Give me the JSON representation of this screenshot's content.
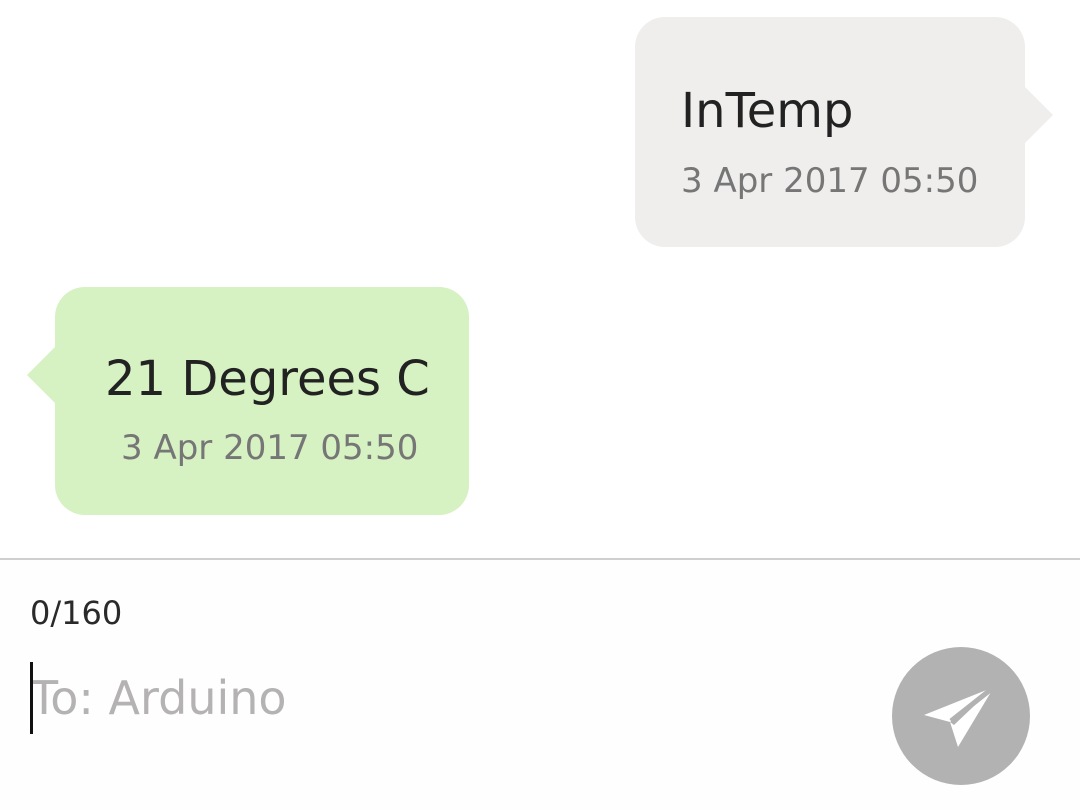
{
  "conversation": {
    "messages": [
      {
        "direction": "outgoing",
        "text": "InTemp",
        "timestamp": "3 Apr 2017 05:50"
      },
      {
        "direction": "incoming",
        "text": "21 Degrees C",
        "timestamp": "3 Apr 2017 05:50"
      }
    ]
  },
  "composer": {
    "char_counter": "0/160",
    "placeholder": "To: Arduino",
    "value": "",
    "send_icon": "send-icon"
  },
  "colors": {
    "outgoing_bubble": "#efeeed",
    "incoming_bubble": "#d6f1c2",
    "send_button": "#b3b2b3"
  }
}
